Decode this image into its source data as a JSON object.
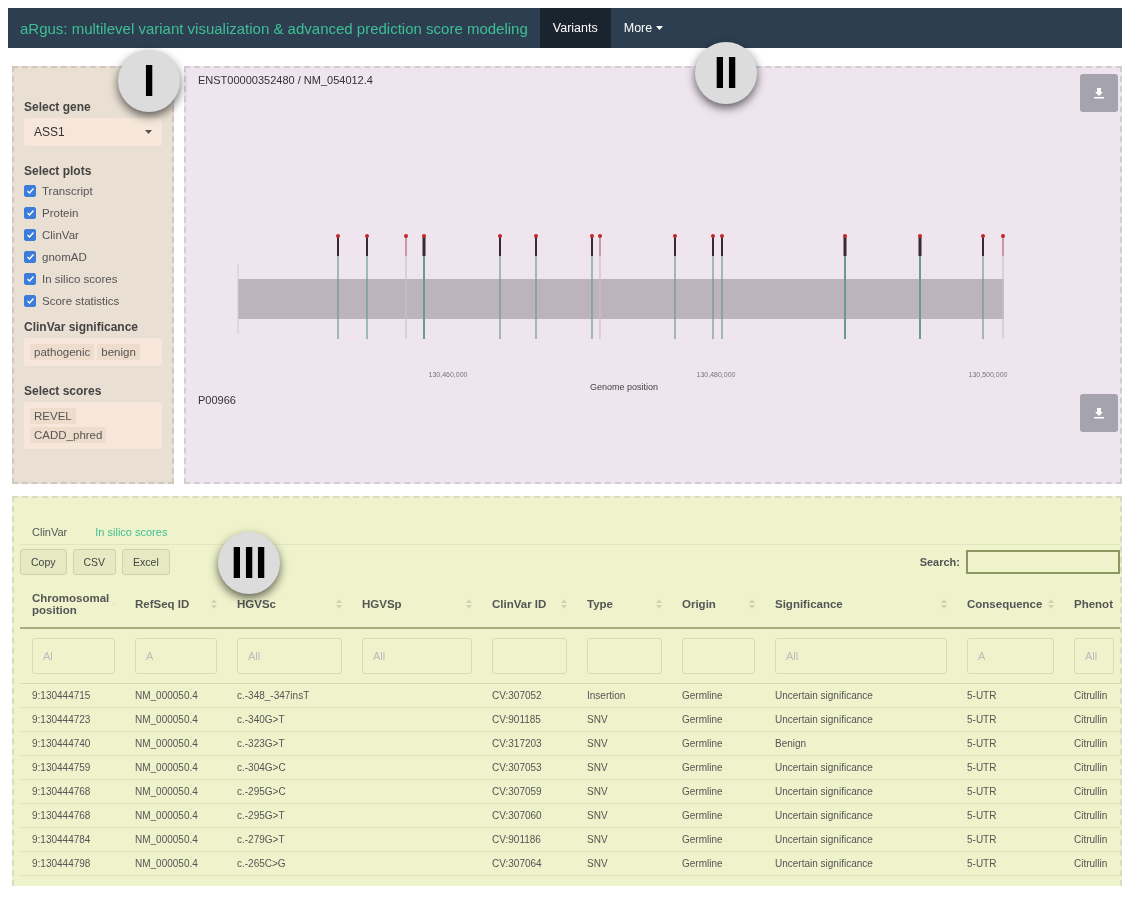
{
  "navbar": {
    "title": "aRgus: multilevel variant visualization & advanced prediction score modeling",
    "items": [
      {
        "label": "Variants",
        "selected": true,
        "dropdown": false
      },
      {
        "label": "More",
        "selected": false,
        "dropdown": true
      }
    ]
  },
  "callouts": [
    "I",
    "II",
    "III"
  ],
  "sidebar": {
    "gene_label": "Select gene",
    "gene_value": "ASS1",
    "plots_label": "Select plots",
    "plots": [
      {
        "label": "Transcript",
        "checked": true
      },
      {
        "label": "Protein",
        "checked": true
      },
      {
        "label": "ClinVar",
        "checked": true
      },
      {
        "label": "gnomAD",
        "checked": true
      },
      {
        "label": "In silico scores",
        "checked": true
      },
      {
        "label": "Score statistics",
        "checked": true
      }
    ],
    "significance_label": "ClinVar significance",
    "significance_tags": [
      "pathogenic",
      "benign"
    ],
    "scores_label": "Select scores",
    "scores": [
      "REVEL",
      "CADD_phred"
    ]
  },
  "plot_panel": {
    "transcript_id": "ENST00000352480 / NM_054012.4",
    "xticks": [
      "130,460,000",
      "130,480,000",
      "130,500,000"
    ],
    "xlabel": "Genome position",
    "protein_id": "P00966"
  },
  "table_panel": {
    "tabs": [
      {
        "label": "ClinVar",
        "selected": true
      },
      {
        "label": "In silico scores",
        "selected": false
      }
    ],
    "buttons": [
      "Copy",
      "CSV",
      "Excel"
    ],
    "search_label": "Search:",
    "columns": [
      {
        "label": "Chromosomal position",
        "sort_icon": true,
        "placeholder": "Al"
      },
      {
        "label": "RefSeq ID",
        "sort_icon": true,
        "placeholder": "A"
      },
      {
        "label": "HGVSc",
        "sort_icon": true,
        "placeholder": "All"
      },
      {
        "label": "HGVSp",
        "sort_icon": true,
        "placeholder": "All"
      },
      {
        "label": "ClinVar ID",
        "sort_icon": true
      },
      {
        "label": "Type",
        "sort_icon": true
      },
      {
        "label": "Origin",
        "sort_icon": true
      },
      {
        "label": "Significance",
        "sort_icon": true,
        "placeholder": "All"
      },
      {
        "label": "Consequence",
        "sort_icon": true,
        "placeholder": "A"
      },
      {
        "label": "Phenot",
        "sort_icon": false,
        "placeholder": "All"
      }
    ],
    "rows": [
      [
        "9:130444715",
        "NM_000050.4",
        "c.-348_-347insT",
        "",
        "CV:307052",
        "Insertion",
        "Germline",
        "Uncertain significance",
        "5-UTR",
        "Citrullin"
      ],
      [
        "9:130444723",
        "NM_000050.4",
        "c.-340G>T",
        "",
        "CV:901185",
        "SNV",
        "Germline",
        "Uncertain significance",
        "5-UTR",
        "Citrullin"
      ],
      [
        "9:130444740",
        "NM_000050.4",
        "c.-323G>T",
        "",
        "CV:317203",
        "SNV",
        "Germline",
        "Benign",
        "5-UTR",
        "Citrullin"
      ],
      [
        "9:130444759",
        "NM_000050.4",
        "c.-304G>C",
        "",
        "CV:307053",
        "SNV",
        "Germline",
        "Uncertain significance",
        "5-UTR",
        "Citrullin"
      ],
      [
        "9:130444768",
        "NM_000050.4",
        "c.-295G>C",
        "",
        "CV:307059",
        "SNV",
        "Germline",
        "Uncertain significance",
        "5-UTR",
        "Citrullin"
      ],
      [
        "9:130444768",
        "NM_000050.4",
        "c.-295G>T",
        "",
        "CV:307060",
        "SNV",
        "Germline",
        "Uncertain significance",
        "5-UTR",
        "Citrullin"
      ],
      [
        "9:130444784",
        "NM_000050.4",
        "c.-279G>T",
        "",
        "CV:901186",
        "SNV",
        "Germline",
        "Uncertain significance",
        "5-UTR",
        "Citrullin"
      ],
      [
        "9:130444798",
        "NM_000050.4",
        "c.-265C>G",
        "",
        "CV:307064",
        "SNV",
        "Germline",
        "Uncertain significance",
        "5-UTR",
        "Citrullin"
      ]
    ]
  }
}
